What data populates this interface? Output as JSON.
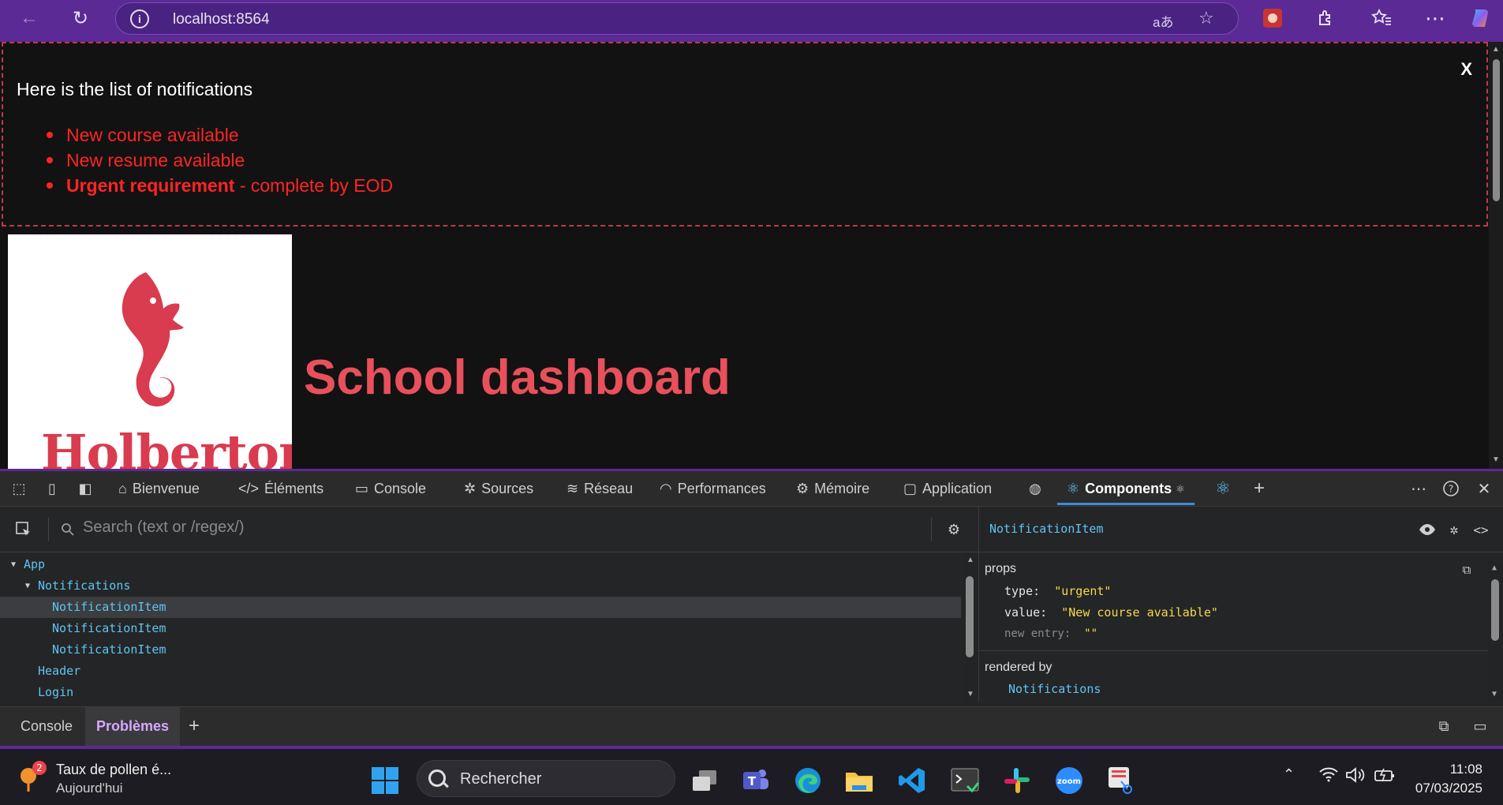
{
  "browser": {
    "url": "localhost:8564",
    "back_icon": "←",
    "reload_icon": "↻",
    "read_aloud_icon": "aあ",
    "favorite_icon": "☆"
  },
  "notifications": {
    "title": "Here is the list of notifications",
    "close_label": "X",
    "items": [
      {
        "text": "New course available"
      },
      {
        "text": "New resume available"
      },
      {
        "strong": "Urgent requirement",
        "text": " - complete by EOD"
      }
    ]
  },
  "header": {
    "logo_text": "Holberton",
    "title": "School dashboard"
  },
  "devtools": {
    "tabs": [
      {
        "label": "Bienvenue",
        "icon": "⌂"
      },
      {
        "label": "Éléments",
        "icon": "</>"
      },
      {
        "label": "Console",
        "icon": "▭"
      },
      {
        "label": "Sources",
        "icon": "✲"
      },
      {
        "label": "Réseau",
        "icon": "≋"
      },
      {
        "label": "Performances",
        "icon": "◠"
      },
      {
        "label": "Mémoire",
        "icon": "⚙"
      },
      {
        "label": "Application",
        "icon": "▢"
      },
      {
        "label": "Components",
        "icon": "⚛",
        "active": true
      }
    ],
    "search_placeholder": "Search (text or /regex/)",
    "tree": [
      {
        "label": "App",
        "indent": 0,
        "arrow": "▼"
      },
      {
        "label": "Notifications",
        "indent": 1,
        "arrow": "▼"
      },
      {
        "label": "NotificationItem",
        "indent": 2,
        "selected": true
      },
      {
        "label": "NotificationItem",
        "indent": 2
      },
      {
        "label": "NotificationItem",
        "indent": 2
      },
      {
        "label": "Header",
        "indent": 1
      },
      {
        "label": "Login",
        "indent": 1
      }
    ],
    "inspector": {
      "component": "NotificationItem",
      "props_label": "props",
      "props": [
        {
          "key": "type",
          "value": "\"urgent\""
        },
        {
          "key": "value",
          "value": "\"New course available\""
        },
        {
          "key": "new entry",
          "value": "\"\"",
          "placeholder": true
        }
      ],
      "rendered_by_label": "rendered by",
      "rendered_by": "Notifications"
    },
    "drawer_tabs": [
      {
        "label": "Console"
      },
      {
        "label": "Problèmes",
        "active": true
      }
    ]
  },
  "taskbar": {
    "pollen_badge": "2",
    "pollen_title": "Taux de pollen é...",
    "pollen_subtitle": "Aujourd'hui",
    "search_placeholder": "Rechercher",
    "time": "11:08",
    "date": "07/03/2025"
  }
}
